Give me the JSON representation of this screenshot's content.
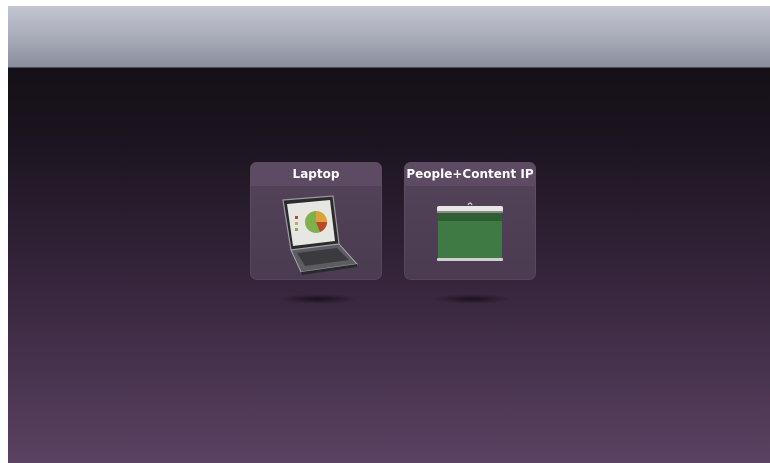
{
  "sources": [
    {
      "label": "Laptop",
      "icon": "laptop-icon"
    },
    {
      "label": "People+Content IP",
      "icon": "projection-screen-icon"
    }
  ],
  "colors": {
    "top_bar": "#a9adba",
    "background_top": "#0f0c10",
    "background_bottom": "#5a4262",
    "tile": "#4f3f56",
    "screen_green": "#3f7a45"
  }
}
